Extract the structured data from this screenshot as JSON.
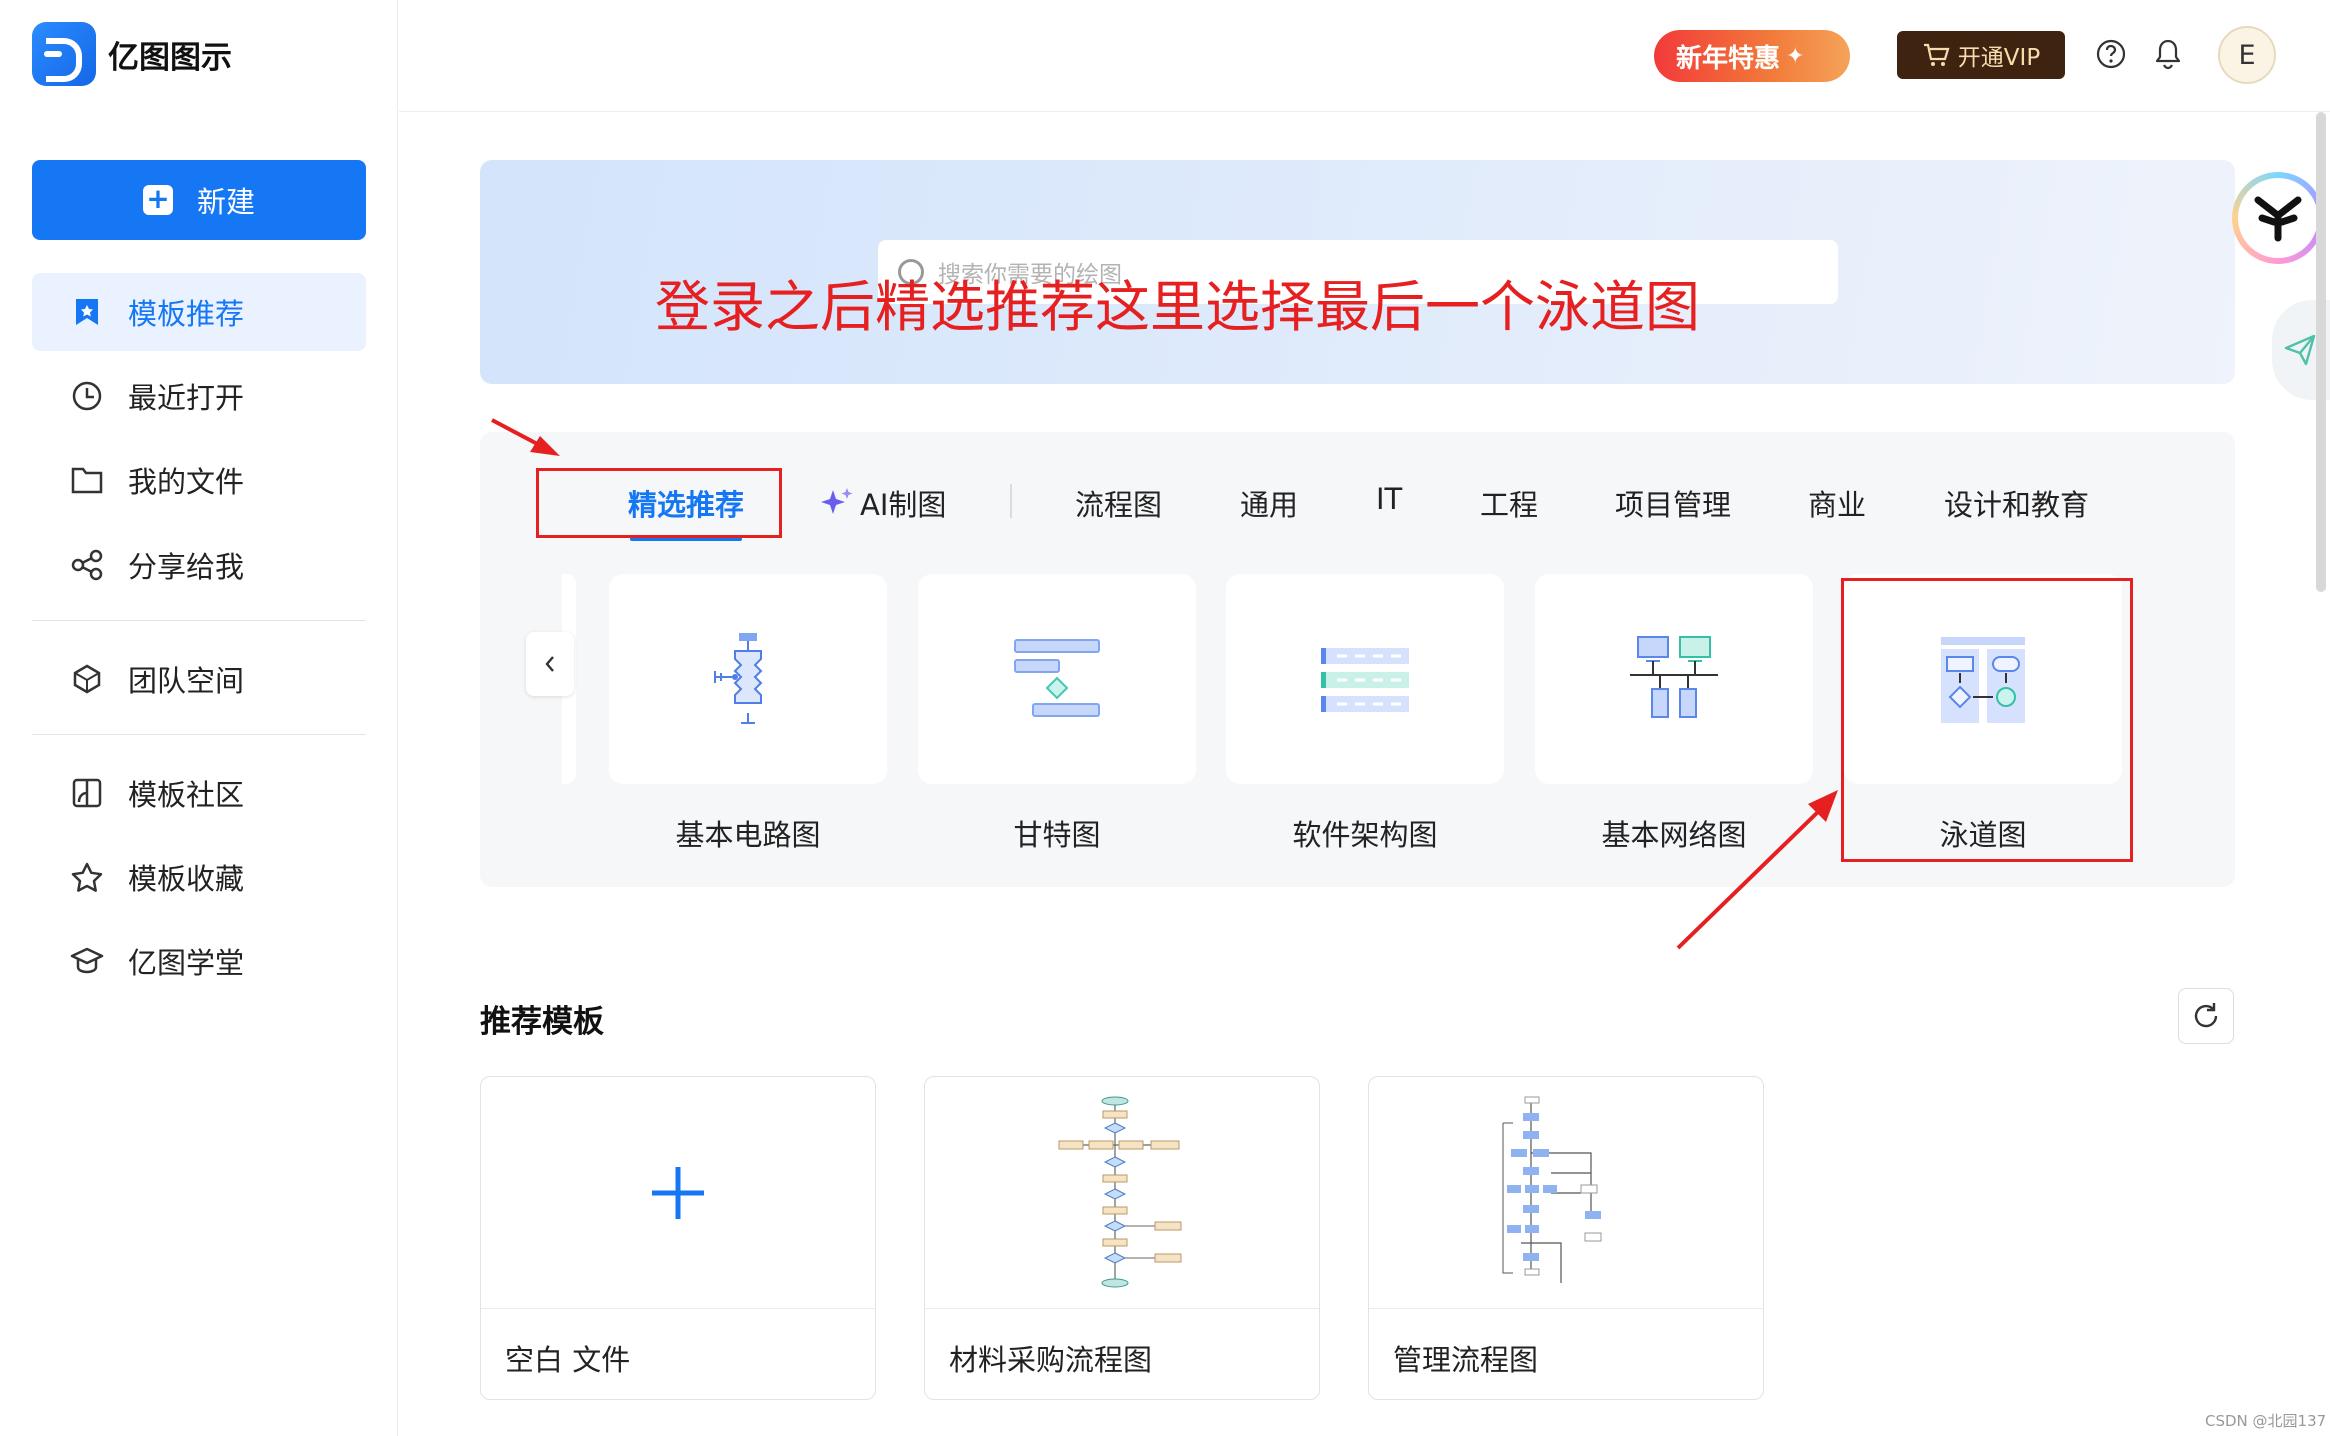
{
  "app": {
    "name": "亿图图示"
  },
  "sidebar": {
    "new_label": "新建",
    "items": [
      {
        "label": "模板推荐",
        "icon": "bookmark-star-icon"
      },
      {
        "label": "最近打开",
        "icon": "clock-icon"
      },
      {
        "label": "我的文件",
        "icon": "folder-icon"
      },
      {
        "label": "分享给我",
        "icon": "share-icon"
      },
      {
        "label": "团队空间",
        "icon": "cube-icon"
      },
      {
        "label": "模板社区",
        "icon": "community-icon"
      },
      {
        "label": "模板收藏",
        "icon": "star-icon"
      },
      {
        "label": "亿图学堂",
        "icon": "graduation-cap-icon"
      }
    ]
  },
  "topbar": {
    "promo_label": "新年特惠",
    "vip_label": "开通VIP",
    "avatar_letter": "E"
  },
  "hero": {
    "search_placeholder": "搜索你需要的绘图",
    "annotation": "登录之后精选推荐这里选择最后一个泳道图"
  },
  "tabs": [
    {
      "label": "精选推荐",
      "active": true
    },
    {
      "label": "AI制图",
      "icon": "sparkle-icon"
    },
    {
      "label": "流程图"
    },
    {
      "label": "通用"
    },
    {
      "label": "IT"
    },
    {
      "label": "工程"
    },
    {
      "label": "项目管理"
    },
    {
      "label": "商业"
    },
    {
      "label": "设计和教育"
    }
  ],
  "categories": [
    {
      "label": "基本电路图"
    },
    {
      "label": "甘特图"
    },
    {
      "label": "软件架构图"
    },
    {
      "label": "基本网络图"
    },
    {
      "label": "泳道图"
    }
  ],
  "recommended": {
    "title": "推荐模板",
    "templates": [
      {
        "label": "空白 文件"
      },
      {
        "label": "材料采购流程图"
      },
      {
        "label": "管理流程图"
      }
    ]
  },
  "watermark": "CSDN @北园137",
  "colors": {
    "accent": "#1677f5",
    "annotation_red": "#e62020",
    "vip_bg": "#3e2410"
  }
}
